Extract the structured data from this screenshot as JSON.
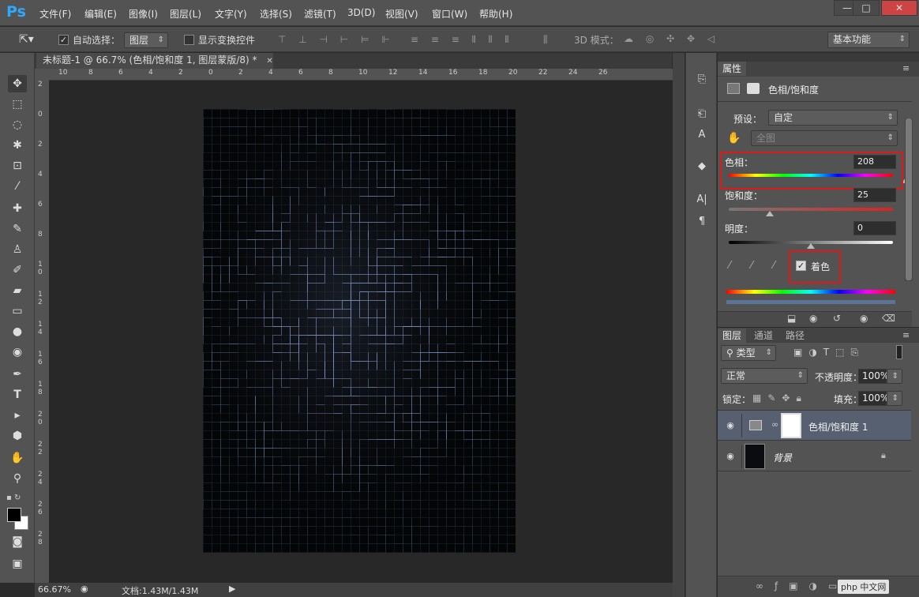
{
  "app": {
    "logo": "Ps"
  },
  "menu": [
    "文件(F)",
    "编辑(E)",
    "图像(I)",
    "图层(L)",
    "文字(Y)",
    "选择(S)",
    "滤镜(T)",
    "3D(D)",
    "视图(V)",
    "窗口(W)",
    "帮助(H)"
  ],
  "window_controls": {
    "minimize": "—",
    "maximize": "□",
    "close": "✕"
  },
  "options": {
    "auto_select_label": "自动选择：",
    "auto_select_checked": "✓",
    "auto_select_target": "图层",
    "show_transform_label": "显示变换控件",
    "mode3d_label": "3D 模式：",
    "workspace": "基本功能"
  },
  "document": {
    "tab_title": "未标题-1 @ 66.7% (色相/饱和度 1, 图层蒙版/8) *",
    "close_icon": "✕",
    "zoom": "66.67%",
    "doc_size": "文档:1.43M/1.43M"
  },
  "ruler": {
    "h": [
      "10",
      "8",
      "6",
      "4",
      "2",
      "0",
      "2",
      "4",
      "6",
      "8",
      "10",
      "12",
      "14",
      "16",
      "18",
      "20",
      "22",
      "24",
      "26"
    ],
    "v": [
      "2",
      "0",
      "2",
      "4",
      "6",
      "8",
      "1 0",
      "1 2",
      "1 4",
      "1 6",
      "1 8",
      "2 0",
      "2 2",
      "2 4",
      "2 6",
      "2 8"
    ]
  },
  "properties": {
    "tab": "属性",
    "adjustment_title": "色相/饱和度",
    "preset_label": "预设：",
    "preset_value": "自定",
    "channel_value": "全图",
    "hue_label": "色相：",
    "hue_value": "208",
    "saturation_label": "饱和度：",
    "saturation_value": "25",
    "lightness_label": "明度：",
    "lightness_value": "0",
    "colorize_label": "着色",
    "colorize_checked": "✓",
    "hue_level": 208,
    "hue_range": [
      0,
      360
    ],
    "saturation_level": 25,
    "saturation_range": [
      0,
      100
    ],
    "lightness_level": 0,
    "lightness_range": [
      -100,
      100
    ]
  },
  "layers_panel": {
    "tabs": [
      "图层",
      "通道",
      "路径"
    ],
    "filter_label": "类型",
    "blend_mode": "正常",
    "opacity_label": "不透明度：",
    "opacity_value": "100%",
    "lock_label": "锁定：",
    "fill_label": "填充：",
    "fill_value": "100%",
    "layers": [
      {
        "name": "色相/饱和度 1",
        "selected": true
      },
      {
        "name": "背景",
        "selected": false
      }
    ]
  },
  "colors": {
    "accent": "#31a8ff",
    "highlight_box": "#e01818",
    "selected_layer": "#576070"
  },
  "watermark": "php 中文网"
}
